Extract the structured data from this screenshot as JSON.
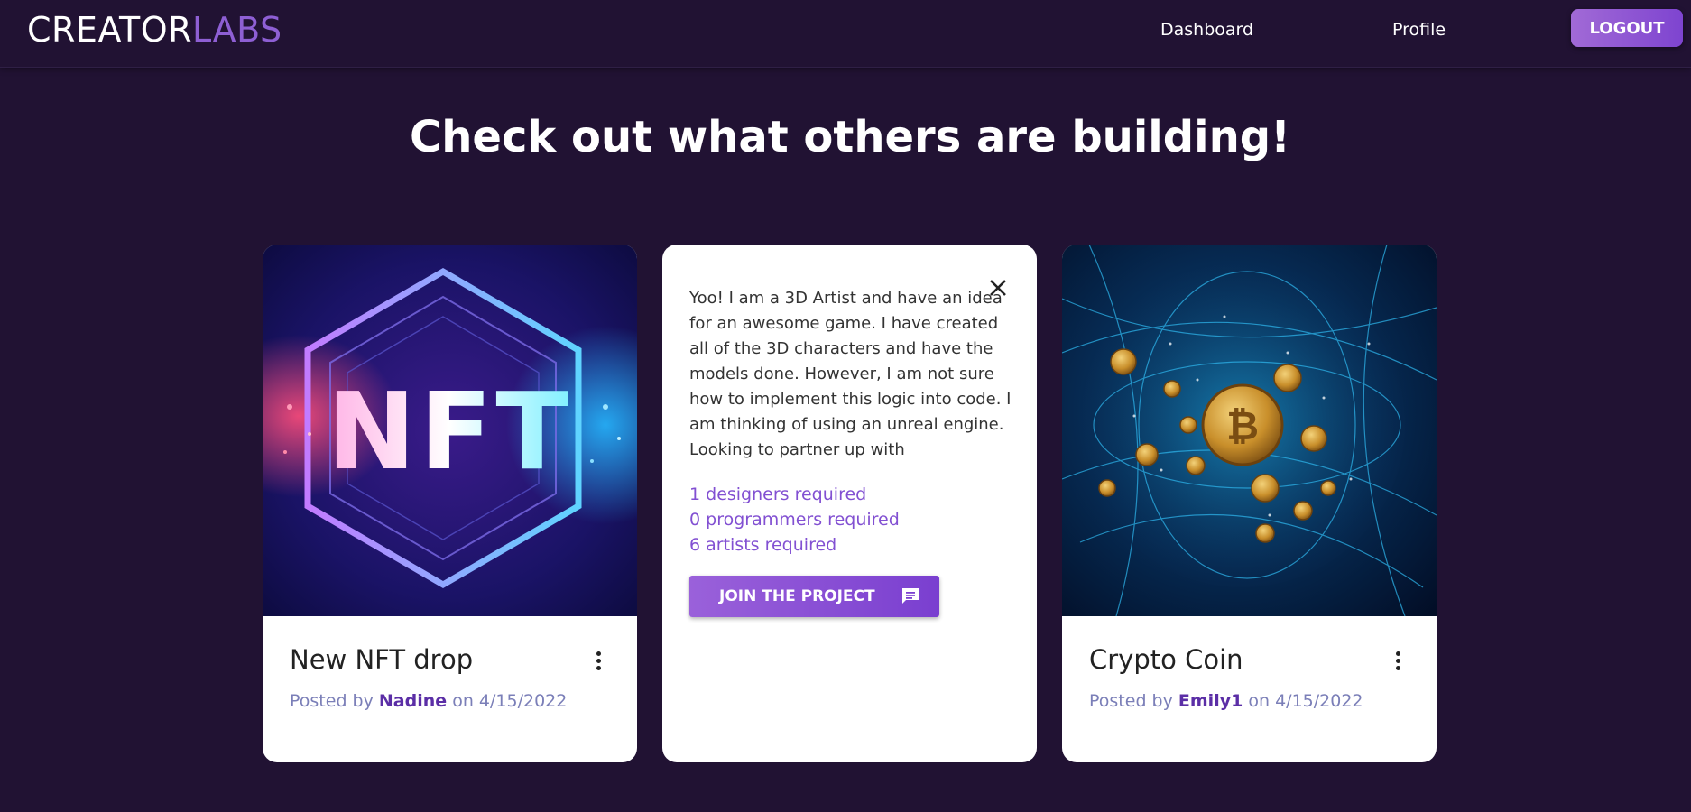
{
  "nav": {
    "brand_part1": "CREATOR",
    "brand_part2": "LABS",
    "dashboard": "Dashboard",
    "profile": "Profile",
    "logout": "LOGOUT"
  },
  "page": {
    "heading": "Check out what others are building!"
  },
  "cards": [
    {
      "title": "New NFT drop",
      "posted_by": "Posted by",
      "author": "Nadine",
      "on": "on",
      "date": "4/15/2022",
      "image_text": "NFT"
    },
    {
      "description": "Yoo! I am a 3D Artist and have an idea for an awesome game. I have created all of the 3D characters and have the models done. However, I am not sure how to implement this logic into code. I am thinking of using an unreal engine. Looking to partner up with",
      "designers": "1 designers required",
      "programmers": "0 programmers required",
      "artists": "6 artists required",
      "join_label": "JOIN THE PROJECT"
    },
    {
      "title": "Crypto Coin",
      "posted_by": "Posted by",
      "author": "Emily1",
      "on": "on",
      "date": "4/15/2022"
    }
  ],
  "colors": {
    "background": "#211233",
    "accent": "#8e5fd4",
    "button_gradient_start": "#a16ad6",
    "button_gradient_end": "#7e44d0"
  }
}
